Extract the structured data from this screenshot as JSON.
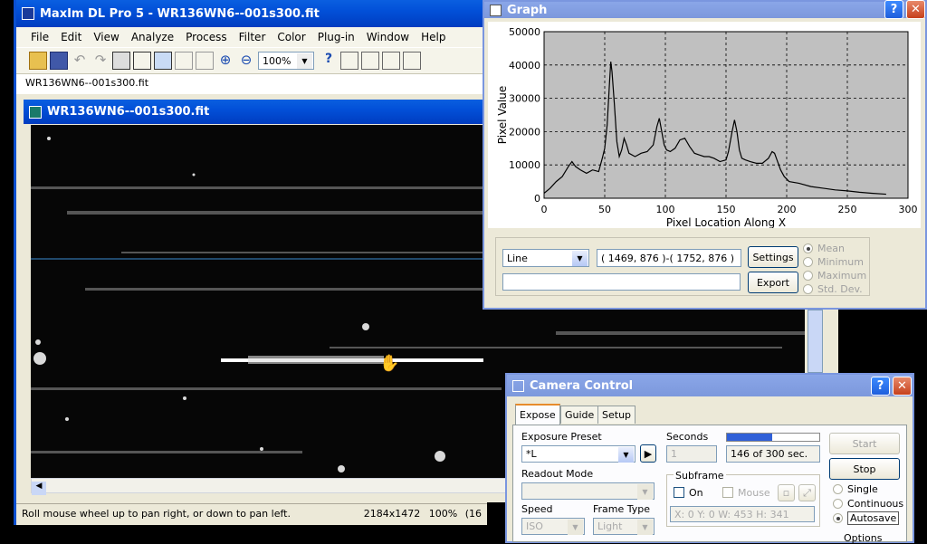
{
  "main": {
    "title": "MaxIm DL Pro 5 - WR136WN6--001s300.fit",
    "menu": [
      "File",
      "Edit",
      "View",
      "Analyze",
      "Process",
      "Filter",
      "Color",
      "Plug-in",
      "Window",
      "Help"
    ],
    "zoom": "100%",
    "doc_tab": "WR136WN6--001s300.fit",
    "status_hint": "Roll mouse wheel up to pan right, or down to pan left.",
    "status_dims": "2184x1472",
    "status_zoom": "100%",
    "status_more": "(16"
  },
  "image_window": {
    "title": "WR136WN6--001s300.fit"
  },
  "graph": {
    "title": "Graph",
    "mode": "Line",
    "coords": "( 1469, 876 )-( 1752, 876 )",
    "settings_label": "Settings",
    "export_label": "Export",
    "options": [
      "Mean",
      "Minimum",
      "Maximum",
      "Std. Dev."
    ]
  },
  "chart_data": {
    "type": "line",
    "xlabel": "Pixel Location Along X",
    "ylabel": "Pixel Value",
    "xlim": [
      0,
      300
    ],
    "ylim": [
      0,
      50000
    ],
    "xticks": [
      "0",
      "50",
      "100",
      "150",
      "200",
      "250",
      "300"
    ],
    "yticks": [
      "0",
      "10000",
      "20000",
      "30000",
      "40000",
      "50000"
    ],
    "grid": true,
    "x": [
      0,
      5,
      10,
      15,
      20,
      23,
      26,
      30,
      35,
      40,
      45,
      48,
      50,
      52,
      54,
      55,
      56,
      58,
      60,
      62,
      64,
      66,
      68,
      70,
      75,
      80,
      85,
      90,
      93,
      95,
      97,
      99,
      101,
      104,
      108,
      112,
      116,
      120,
      124,
      128,
      132,
      136,
      140,
      145,
      150,
      152,
      155,
      157,
      159,
      161,
      163,
      166,
      170,
      175,
      180,
      185,
      188,
      190,
      192,
      195,
      198,
      202,
      210,
      220,
      230,
      240,
      250,
      260,
      270,
      282
    ],
    "y": [
      1500,
      3000,
      5000,
      6500,
      9500,
      11000,
      9500,
      8500,
      7500,
      8500,
      8000,
      12000,
      15000,
      22000,
      35000,
      41000,
      38000,
      28000,
      17000,
      12500,
      14500,
      18000,
      16000,
      13500,
      12500,
      13500,
      14000,
      16000,
      21500,
      24000,
      20000,
      16000,
      14500,
      14000,
      15000,
      17500,
      18000,
      15500,
      13500,
      13000,
      12500,
      12500,
      12000,
      11000,
      11500,
      14000,
      20000,
      23500,
      20000,
      14500,
      12000,
      11500,
      11000,
      10500,
      10500,
      12000,
      14000,
      13500,
      11500,
      8500,
      6500,
      5000,
      4500,
      3500,
      3000,
      2500,
      2200,
      1800,
      1500,
      1200
    ],
    "series": [
      {
        "values_ref": "y"
      }
    ]
  },
  "camera": {
    "title": "Camera Control",
    "tabs": [
      "Expose",
      "Guide",
      "Setup"
    ],
    "exposure_preset_label": "Exposure Preset",
    "exposure_preset": "*L",
    "seconds_label": "Seconds",
    "seconds_value": "1",
    "progress_text": "146 of 300 sec.",
    "progress_fraction": 0.49,
    "start_label": "Start",
    "stop_label": "Stop",
    "readout_label": "Readout Mode",
    "subframe_label": "Subframe",
    "on_label": "On",
    "mouse_label": "Mouse",
    "subframe_coords": "X:   0 Y:   0 W: 453 H: 341",
    "speed_label": "Speed",
    "speed_value": "ISO",
    "frame_type_label": "Frame Type",
    "frame_type_value": "Light",
    "single_label": "Single",
    "continuous_label": "Continuous",
    "autosave_label": "Autosave",
    "options_label": "Options"
  }
}
